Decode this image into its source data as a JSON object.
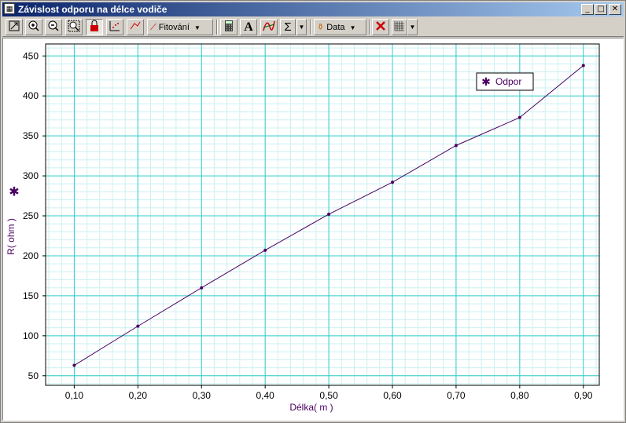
{
  "window": {
    "title": "Závislost odporu na délce vodiče",
    "minimize_glyph": "_",
    "maximize_glyph": "□",
    "close_glyph": "✕"
  },
  "toolbar": {
    "fit_label": "Fitování",
    "data_label": "Data",
    "text_tool_glyph": "A",
    "sum_glyph": "Σ",
    "dropdown_glyph": "▼"
  },
  "colors": {
    "grid": "#33cccc",
    "minor_grid": "#ccf0f0",
    "series": "#4b0063",
    "accent_delete": "#cc0000"
  },
  "chart_data": {
    "type": "line",
    "title": "",
    "xlabel": "Délka( m )",
    "ylabel": "R( ohm )",
    "xlim": [
      0.055,
      0.925
    ],
    "ylim": [
      38,
      465
    ],
    "x_ticks": [
      0.1,
      0.2,
      0.3,
      0.4,
      0.5,
      0.6,
      0.7,
      0.8,
      0.9
    ],
    "x_tick_labels": [
      "0,10",
      "0,20",
      "0,30",
      "0,40",
      "0,50",
      "0,60",
      "0,70",
      "0,80",
      "0,90"
    ],
    "y_ticks": [
      50,
      100,
      150,
      200,
      250,
      300,
      350,
      400,
      450
    ],
    "y_tick_labels": [
      "50",
      "100",
      "150",
      "200",
      "250",
      "300",
      "350",
      "400",
      "450"
    ],
    "grid": true,
    "legend_position": "top-right",
    "series": [
      {
        "name": "Odpor",
        "marker": "✱",
        "x": [
          0.1,
          0.2,
          0.3,
          0.4,
          0.5,
          0.6,
          0.7,
          0.8,
          0.9
        ],
        "y": [
          63,
          112,
          160,
          207,
          252,
          292,
          338,
          373,
          438
        ]
      }
    ]
  }
}
